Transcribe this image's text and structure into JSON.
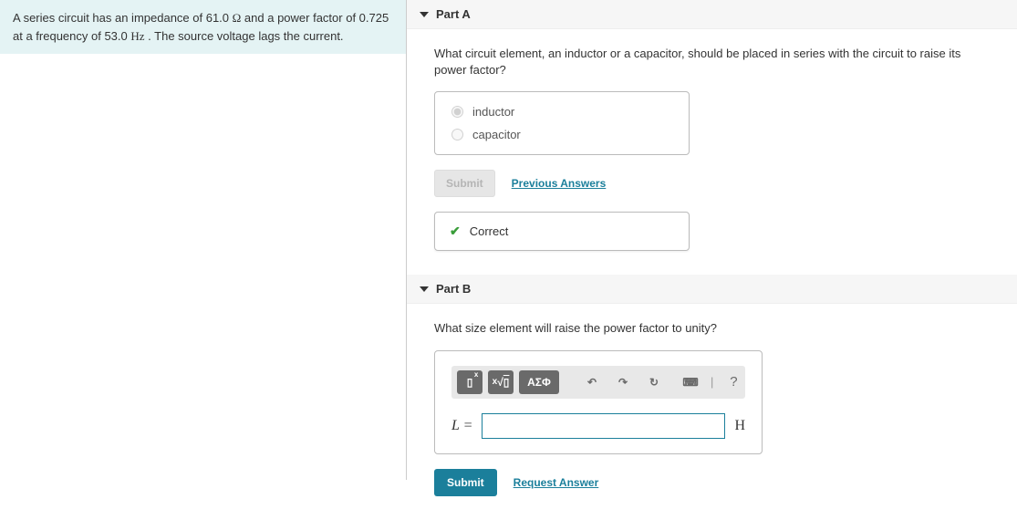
{
  "problem": {
    "text_prefix": "A series circuit has an impedance of 61.0 ",
    "unit1": "Ω",
    "text_mid1": " and a power factor of 0.725 at a frequency of 53.0 ",
    "unit2": "Hz",
    "text_suffix": " . The source voltage lags the current."
  },
  "partA": {
    "title": "Part A",
    "question": "What circuit element, an inductor or a capacitor, should be placed in series with the circuit to raise its power factor?",
    "options": [
      {
        "label": "inductor",
        "checked": true
      },
      {
        "label": "capacitor",
        "checked": false
      }
    ],
    "submit_label": "Submit",
    "previous_answers_label": "Previous Answers",
    "correct_label": "Correct"
  },
  "partB": {
    "title": "Part B",
    "question": "What size element will raise the power factor to unity?",
    "toolbar": {
      "fraction_label": "x",
      "sqrt_label": "√",
      "greek_label": "ΑΣΦ",
      "undo_label": "↶",
      "redo_label": "↷",
      "reset_label": "↻",
      "keyboard_label": "⌨",
      "help_label": "?"
    },
    "lhs": "L =",
    "value": "",
    "unit": "H",
    "submit_label": "Submit",
    "request_answer_label": "Request Answer"
  }
}
